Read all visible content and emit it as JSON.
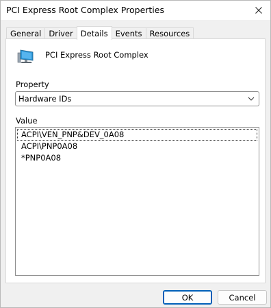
{
  "window": {
    "title": "PCI Express Root Complex Properties",
    "close_icon": "close-icon"
  },
  "tabs": [
    {
      "label": "General",
      "active": false
    },
    {
      "label": "Driver",
      "active": false
    },
    {
      "label": "Details",
      "active": true
    },
    {
      "label": "Events",
      "active": false
    },
    {
      "label": "Resources",
      "active": false
    }
  ],
  "details": {
    "device_icon": "computer-monitor-icon",
    "device_name": "PCI Express Root Complex",
    "property_label": "Property",
    "property_selected": "Hardware IDs",
    "value_label": "Value",
    "values": [
      "ACPI\\VEN_PNP&DEV_0A08",
      "ACPI\\PNP0A08",
      "*PNP0A08"
    ]
  },
  "buttons": {
    "ok": "OK",
    "cancel": "Cancel"
  },
  "colors": {
    "accent": "#005fb8",
    "monitor_screen": "#2b95d6"
  }
}
